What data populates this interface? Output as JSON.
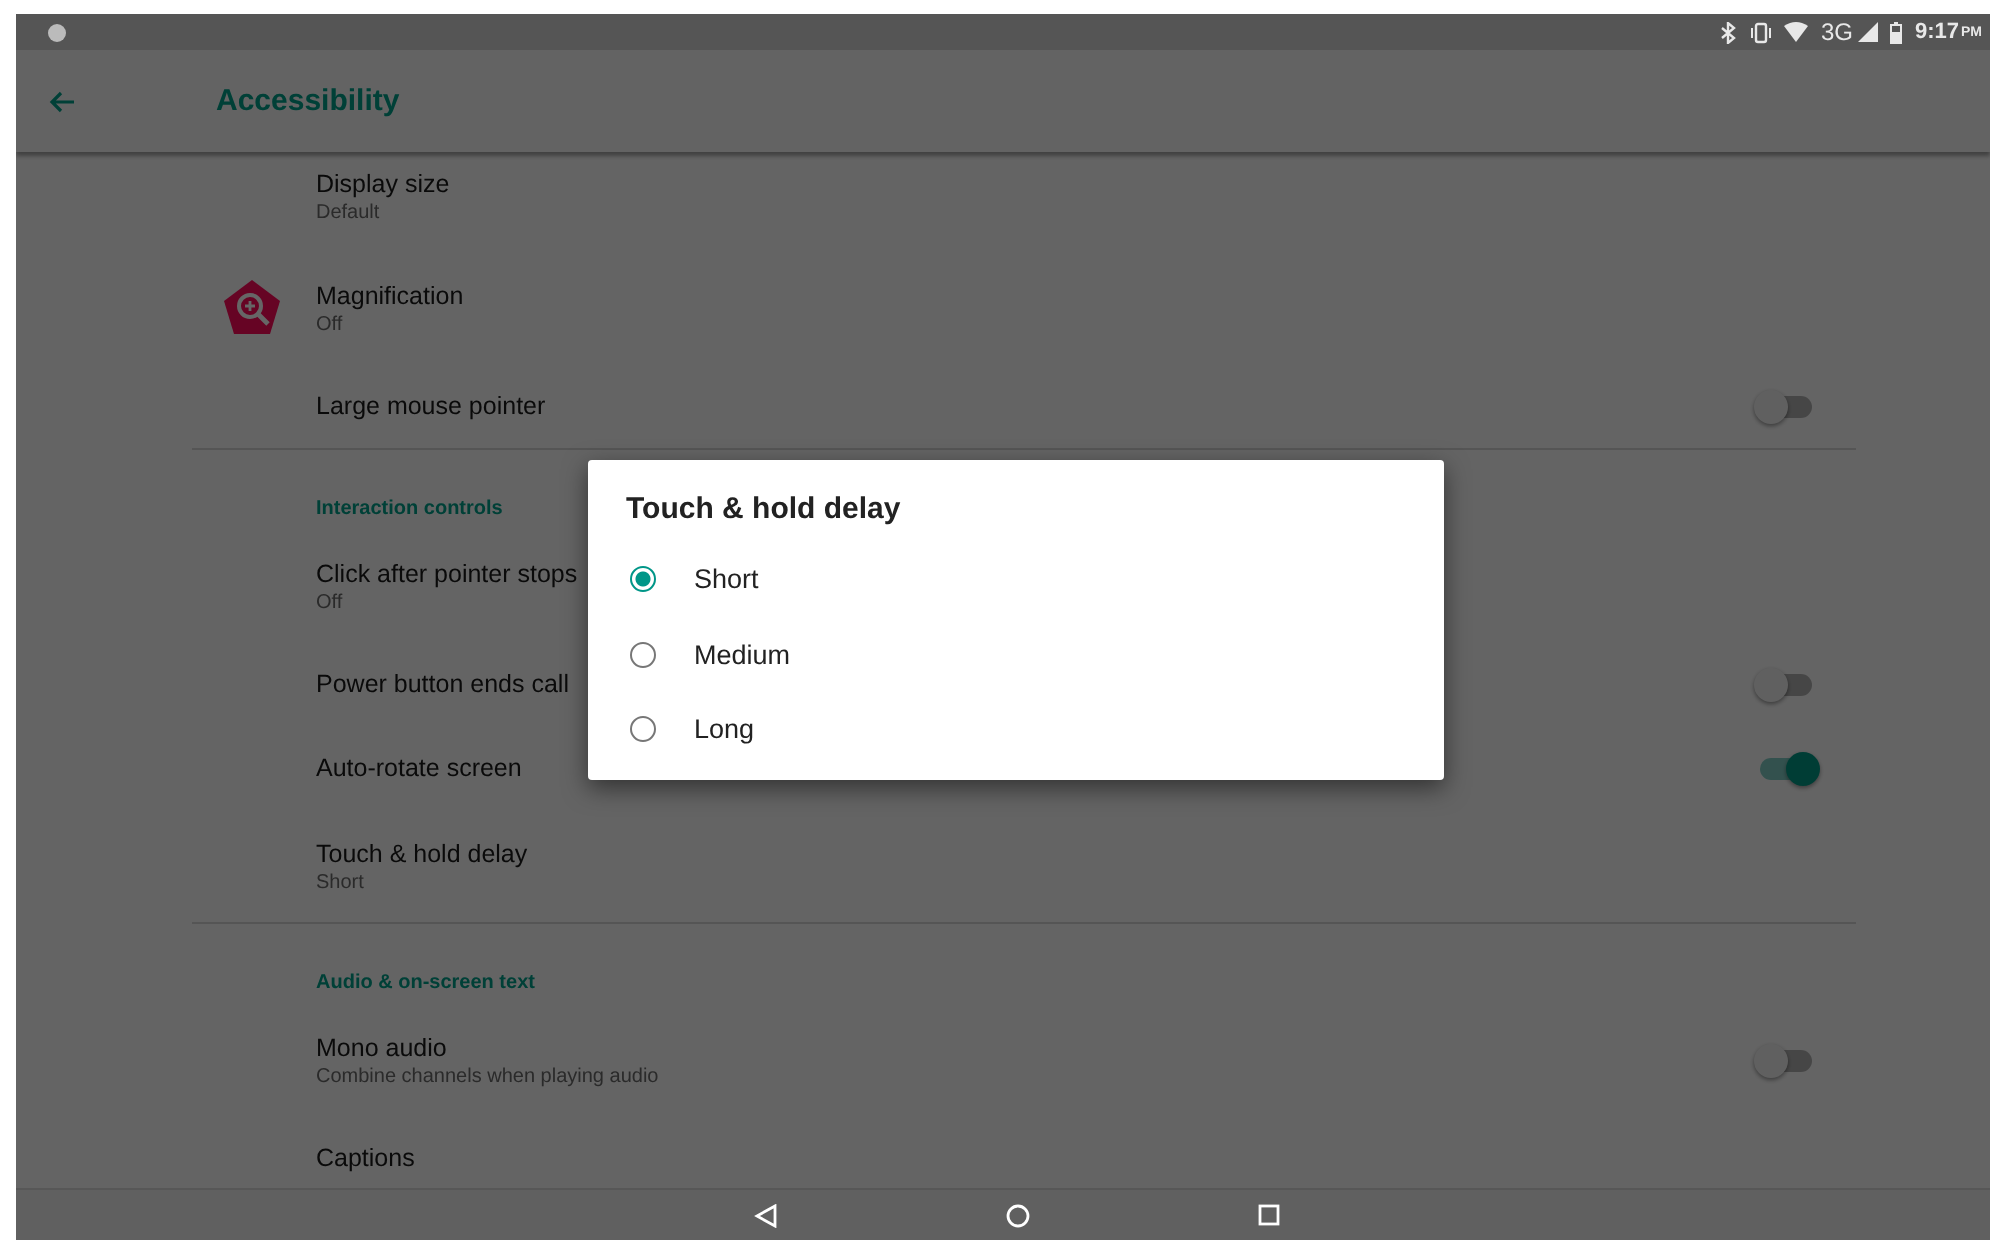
{
  "status_bar": {
    "network": "3G",
    "time": "9:17",
    "period": "PM"
  },
  "app_bar": {
    "title": "Accessibility"
  },
  "rows": [
    {
      "kind": "item",
      "title": "Display size",
      "summary": "Default"
    },
    {
      "kind": "icon_item",
      "title": "Magnification",
      "summary": "Off"
    },
    {
      "kind": "toggle",
      "title": "Large mouse pointer",
      "on": false
    },
    {
      "kind": "header",
      "title": "Interaction controls"
    },
    {
      "kind": "item",
      "title": "Click after pointer stops",
      "summary": "Off"
    },
    {
      "kind": "toggle",
      "title": "Power button ends call",
      "on": false
    },
    {
      "kind": "toggle",
      "title": "Auto-rotate screen",
      "on": true
    },
    {
      "kind": "item",
      "title": "Touch & hold delay",
      "summary": "Short"
    },
    {
      "kind": "header",
      "title": "Audio & on-screen text"
    },
    {
      "kind": "toggle",
      "title": "Mono audio",
      "summary": "Combine channels when playing audio",
      "on": false
    },
    {
      "kind": "item",
      "title": "Captions"
    }
  ],
  "dialog": {
    "title": "Touch & hold delay",
    "options": [
      {
        "label": "Short",
        "selected": true
      },
      {
        "label": "Medium",
        "selected": false
      },
      {
        "label": "Long",
        "selected": false
      }
    ]
  }
}
